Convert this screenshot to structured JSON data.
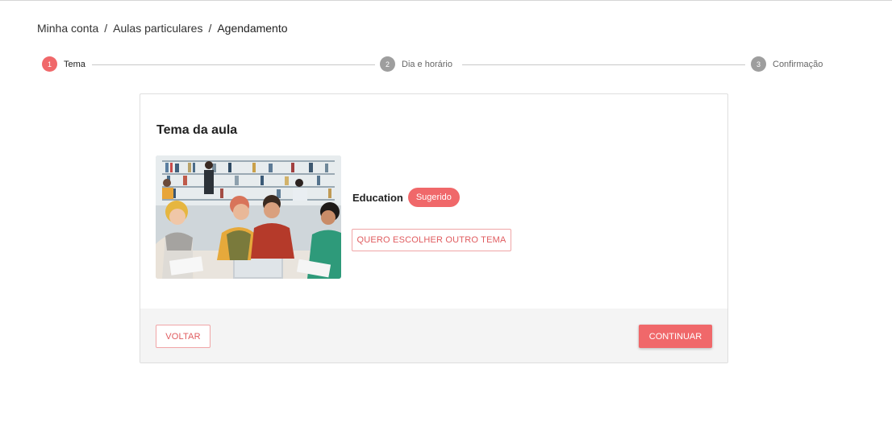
{
  "breadcrumb": {
    "items": [
      "Minha conta",
      "Aulas particulares",
      "Agendamento"
    ],
    "separator": "/"
  },
  "stepper": {
    "steps": [
      {
        "number": "1",
        "label": "Tema",
        "state": "active"
      },
      {
        "number": "2",
        "label": "Dia e horário",
        "state": "inactive"
      },
      {
        "number": "3",
        "label": "Confirmação",
        "state": "inactive"
      }
    ]
  },
  "card": {
    "title": "Tema da aula",
    "topic": "Education",
    "badge": "Sugerido",
    "other_topic_button": "QUERO ESCOLHER OUTRO TEMA"
  },
  "footer": {
    "back_label": "VOLTAR",
    "continue_label": "CONTINUAR"
  },
  "colors": {
    "accent": "#f0686a",
    "inactive_step": "#9e9e9e",
    "footer_bg": "#f4f4f4"
  }
}
